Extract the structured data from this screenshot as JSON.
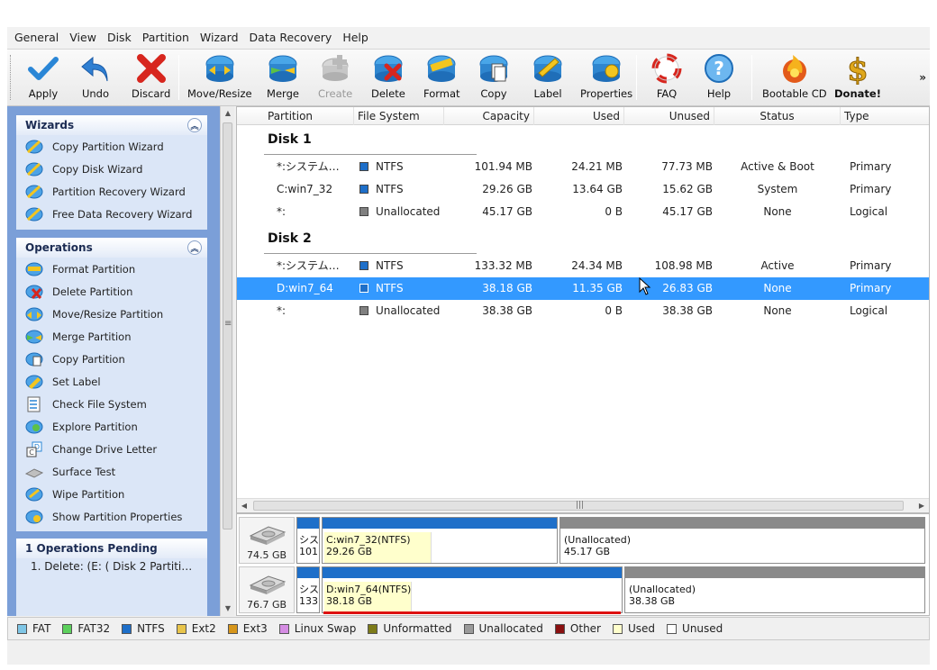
{
  "menu": [
    "General",
    "View",
    "Disk",
    "Partition",
    "Wizard",
    "Data Recovery",
    "Help"
  ],
  "toolbar": {
    "apply": "Apply",
    "undo": "Undo",
    "discard": "Discard",
    "move_resize": "Move/Resize",
    "merge": "Merge",
    "create": "Create",
    "delete": "Delete",
    "format": "Format",
    "copy": "Copy",
    "label": "Label",
    "properties": "Properties",
    "faq": "FAQ",
    "help": "Help",
    "bootable_cd": "Bootable CD",
    "donate": "Donate!",
    "more": "»"
  },
  "wizards": {
    "title": "Wizards",
    "items": [
      "Copy Partition Wizard",
      "Copy Disk Wizard",
      "Partition Recovery Wizard",
      "Free Data Recovery Wizard"
    ]
  },
  "operations": {
    "title": "Operations",
    "items": [
      "Format Partition",
      "Delete Partition",
      "Move/Resize Partition",
      "Merge Partition",
      "Copy Partition",
      "Set Label",
      "Check File System",
      "Explore Partition",
      "Change Drive Letter",
      "Surface Test",
      "Wipe Partition",
      "Show Partition Properties"
    ]
  },
  "pending": {
    "title": "1 Operations Pending",
    "items": [
      "1. Delete: (E: ( Disk 2 Partiti…"
    ]
  },
  "table": {
    "columns": [
      "Partition",
      "File System",
      "Capacity",
      "Used",
      "Unused",
      "Status",
      "Type"
    ],
    "disks": [
      {
        "name": "Disk 1",
        "rows": [
          {
            "partition": "*:システム…",
            "fs": "NTFS",
            "capacity": "101.94 MB",
            "used": "24.21 MB",
            "unused": "77.73 MB",
            "status": "Active & Boot",
            "type": "Primary"
          },
          {
            "partition": "C:win7_32",
            "fs": "NTFS",
            "capacity": "29.26 GB",
            "used": "13.64 GB",
            "unused": "15.62 GB",
            "status": "System",
            "type": "Primary"
          },
          {
            "partition": "*:",
            "fs": "Unallocated",
            "capacity": "45.17 GB",
            "used": "0 B",
            "unused": "45.17 GB",
            "status": "None",
            "type": "Logical"
          }
        ]
      },
      {
        "name": "Disk 2",
        "rows": [
          {
            "partition": "*:システム…",
            "fs": "NTFS",
            "capacity": "133.32 MB",
            "used": "24.34 MB",
            "unused": "108.98 MB",
            "status": "Active",
            "type": "Primary"
          },
          {
            "partition": "D:win7_64",
            "fs": "NTFS",
            "capacity": "38.18 GB",
            "used": "11.35 GB",
            "unused": "26.83 GB",
            "status": "None",
            "type": "Primary",
            "selected": true
          },
          {
            "partition": "*:",
            "fs": "Unallocated",
            "capacity": "38.38 GB",
            "used": "0 B",
            "unused": "38.38 GB",
            "status": "None",
            "type": "Logical"
          }
        ]
      }
    ]
  },
  "diskmap": [
    {
      "size": "74.5 GB",
      "sys_label": "シス",
      "sys_size": "101",
      "part_label": "C:win7_32(NTFS)",
      "part_size": "29.26 GB",
      "part_used_fraction": 0.466,
      "unalloc_label": "(Unallocated)",
      "unalloc_size": "45.17 GB"
    },
    {
      "size": "76.7 GB",
      "sys_label": "シス",
      "sys_size": "133",
      "part_label": "D:win7_64(NTFS)",
      "part_size": "38.18 GB",
      "part_used_fraction": 0.297,
      "unalloc_label": "(Unallocated)",
      "unalloc_size": "38.38 GB"
    }
  ],
  "legend": [
    {
      "name": "FAT",
      "color": "#7fc6e6"
    },
    {
      "name": "FAT32",
      "color": "#5cd05c"
    },
    {
      "name": "NTFS",
      "color": "#1e6fc9"
    },
    {
      "name": "Ext2",
      "color": "#e8c44a"
    },
    {
      "name": "Ext3",
      "color": "#d7961b"
    },
    {
      "name": "Linux Swap",
      "color": "#d58ce3"
    },
    {
      "name": "Unformatted",
      "color": "#7d7b19"
    },
    {
      "name": "Unallocated",
      "color": "#9a9a9a"
    },
    {
      "name": "Other",
      "color": "#8a1010"
    },
    {
      "name": "Used",
      "color": "#ffffcc"
    },
    {
      "name": "Unused",
      "color": "#ffffff"
    }
  ],
  "colors": {
    "ntfs": "#1e6fc9",
    "unallocated": "#808080",
    "selection": "#3399ff",
    "panel": "#7b9fd8"
  }
}
